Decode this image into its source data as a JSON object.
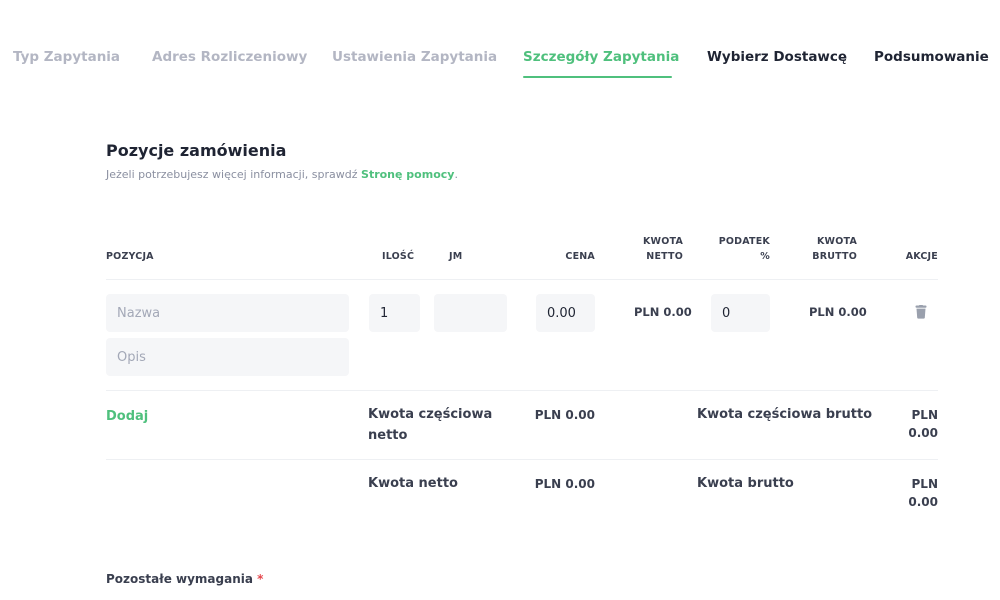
{
  "steps": [
    {
      "label": "Typ Zapytania",
      "state": "done"
    },
    {
      "label": "Adres Rozliczeniowy",
      "state": "done"
    },
    {
      "label": "Ustawienia Zapytania",
      "state": "done"
    },
    {
      "label": "Szczegóły Zapytania",
      "state": "active"
    },
    {
      "label": "Wybierz Dostawcę",
      "state": "todo"
    },
    {
      "label": "Podsumowanie",
      "state": "todo"
    }
  ],
  "section": {
    "title": "Pozycje zamówienia",
    "subtitle_prefix": "Jeżeli potrzebujesz więcej informacji, sprawdź ",
    "help_link": "Stronę pomocy",
    "subtitle_suffix": "."
  },
  "table": {
    "headers": {
      "item": "POZYCJA",
      "qty": "ILOŚĆ",
      "unit": "JM",
      "price": "CENA",
      "net_line1": "KWOTA",
      "net_line2": "NETTO",
      "tax_line1": "PODATEK",
      "tax_line2": "%",
      "gross_line1": "KWOTA",
      "gross_line2": "BRUTTO",
      "actions": "AKCJE"
    },
    "row": {
      "name_placeholder": "Nazwa",
      "desc_placeholder": "Opis",
      "qty": "1",
      "unit": "",
      "price": "0.00",
      "net": "PLN 0.00",
      "tax": "0",
      "gross": "PLN 0.00",
      "delete_icon": "trash-icon"
    }
  },
  "totals": {
    "add_label": "Dodaj",
    "partial_net_label": "Kwota częściowa netto",
    "partial_net_value": "PLN 0.00",
    "partial_gross_label": "Kwota częściowa brutto",
    "partial_gross_value_line1": "PLN",
    "partial_gross_value_line2": "0.00",
    "net_label": "Kwota netto",
    "net_value": "PLN 0.00",
    "gross_label": "Kwota brutto",
    "gross_value_line1": "PLN",
    "gross_value_line2": "0.00"
  },
  "requirements": {
    "label": "Pozostałe wymagania",
    "required_mark": "*"
  },
  "colors": {
    "accent": "#4fc07d",
    "muted_step": "#b3b6c3",
    "text": "#1f2433",
    "input_bg": "#f5f6f8",
    "required": "#e5484d"
  }
}
